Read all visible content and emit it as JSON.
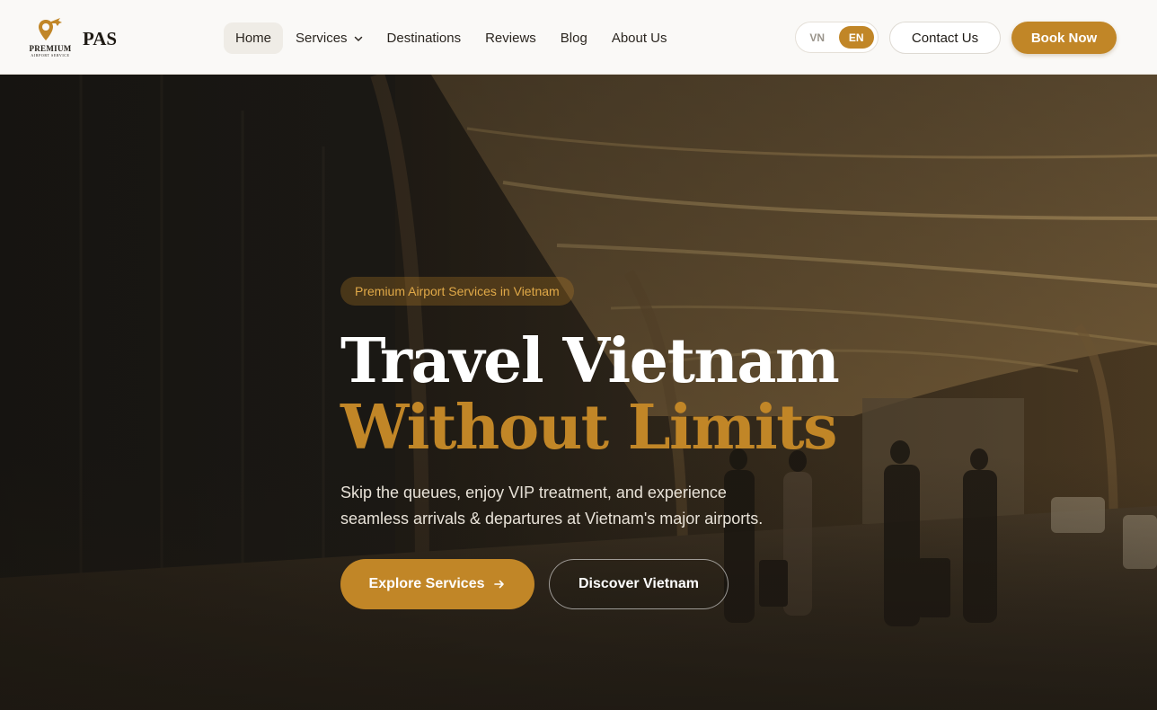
{
  "brand": {
    "logo_top": "PREMIUM",
    "logo_sub": "AIRPORT SERVICE",
    "name": "PAS",
    "accent_color": "#c18627"
  },
  "nav": {
    "items": [
      {
        "label": "Home",
        "active": true
      },
      {
        "label": "Services",
        "has_dropdown": true
      },
      {
        "label": "Destinations"
      },
      {
        "label": "Reviews"
      },
      {
        "label": "Blog"
      },
      {
        "label": "About Us"
      }
    ]
  },
  "lang": {
    "options": [
      "VN",
      "EN"
    ],
    "selected": "EN"
  },
  "header_actions": {
    "contact_label": "Contact Us",
    "book_label": "Book Now"
  },
  "hero": {
    "badge": "Premium Airport Services in Vietnam",
    "title_line1": "Travel Vietnam",
    "title_line2": "Without Limits",
    "description_line1": "Skip the queues, enjoy VIP treatment, and experience",
    "description_line2": "seamless arrivals & departures at Vietnam's major airports.",
    "primary_cta": "Explore Services",
    "secondary_cta": "Discover Vietnam",
    "background": "airport-terminal-photo"
  },
  "icons": {
    "logo": "location-pin-plane-icon",
    "dropdown": "chevron-down-icon",
    "cta_arrow": "arrow-right-icon"
  }
}
